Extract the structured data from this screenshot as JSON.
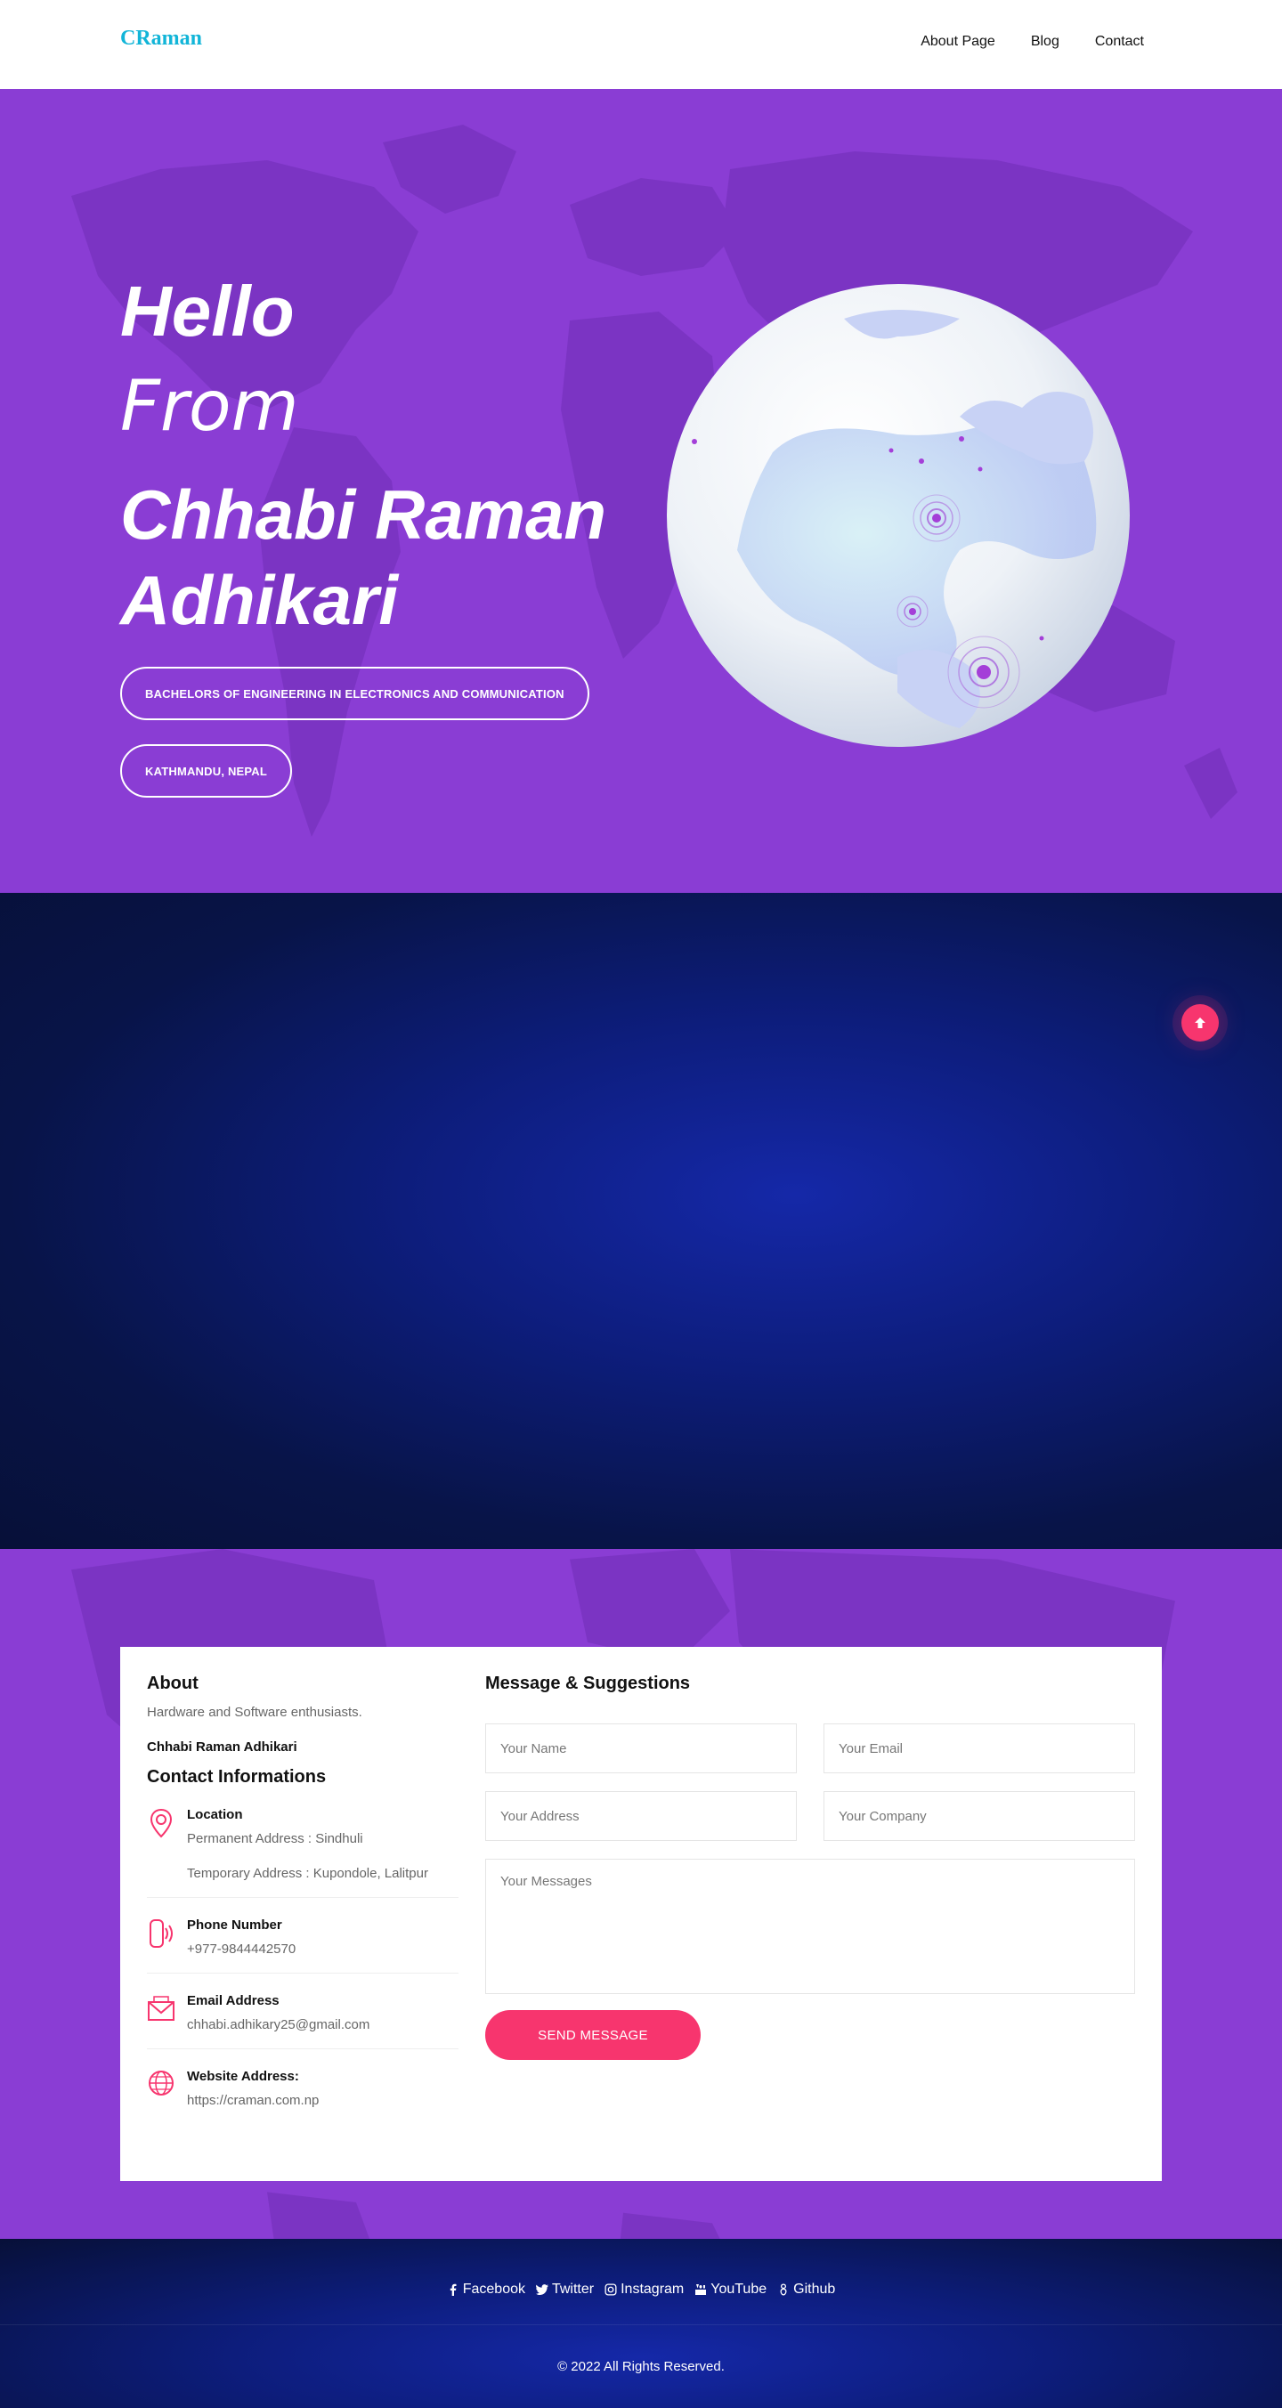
{
  "header": {
    "logo": "CRaman",
    "nav": [
      "About Page",
      "Blog",
      "Contact"
    ]
  },
  "hero": {
    "line1": "Hello",
    "line2": "From",
    "name": "Chhabi Raman Adhikari",
    "badges": [
      "BACHELORS OF ENGINEERING IN ELECTRONICS AND COMMUNICATION",
      "KATHMANDU, NEPAL"
    ]
  },
  "about": {
    "heading": "About",
    "description": "Hardware and Software enthusiasts.",
    "name": "Chhabi Raman Adhikari"
  },
  "contact_info": {
    "heading": "Contact Informations",
    "location": {
      "label": "Location",
      "permanent": "Permanent Address : Sindhuli",
      "temporary": "Temporary Address : Kupondole, Lalitpur"
    },
    "phone": {
      "label": "Phone Number",
      "value": "+977-9844442570"
    },
    "email": {
      "label": "Email Address",
      "value": "chhabi.adhikary25@gmail.com"
    },
    "website": {
      "label": "Website Address:",
      "value": "https://craman.com.np"
    }
  },
  "form": {
    "heading": "Message & Suggestions",
    "name_placeholder": "Your Name",
    "email_placeholder": "Your Email",
    "address_placeholder": "Your Address",
    "company_placeholder": "Your Company",
    "message_placeholder": "Your Messages",
    "submit_label": "SEND MESSAGE"
  },
  "footer": {
    "social": [
      "Facebook",
      "Twitter",
      "Instagram",
      "YouTube",
      "Github"
    ],
    "copyright": "© 2022 All Rights Reserved."
  },
  "colors": {
    "brand_purple": "#8a3dd4",
    "accent_pink": "#f7356e",
    "logo_cyan": "#12b5d8",
    "navy": "#0d1d7c"
  }
}
